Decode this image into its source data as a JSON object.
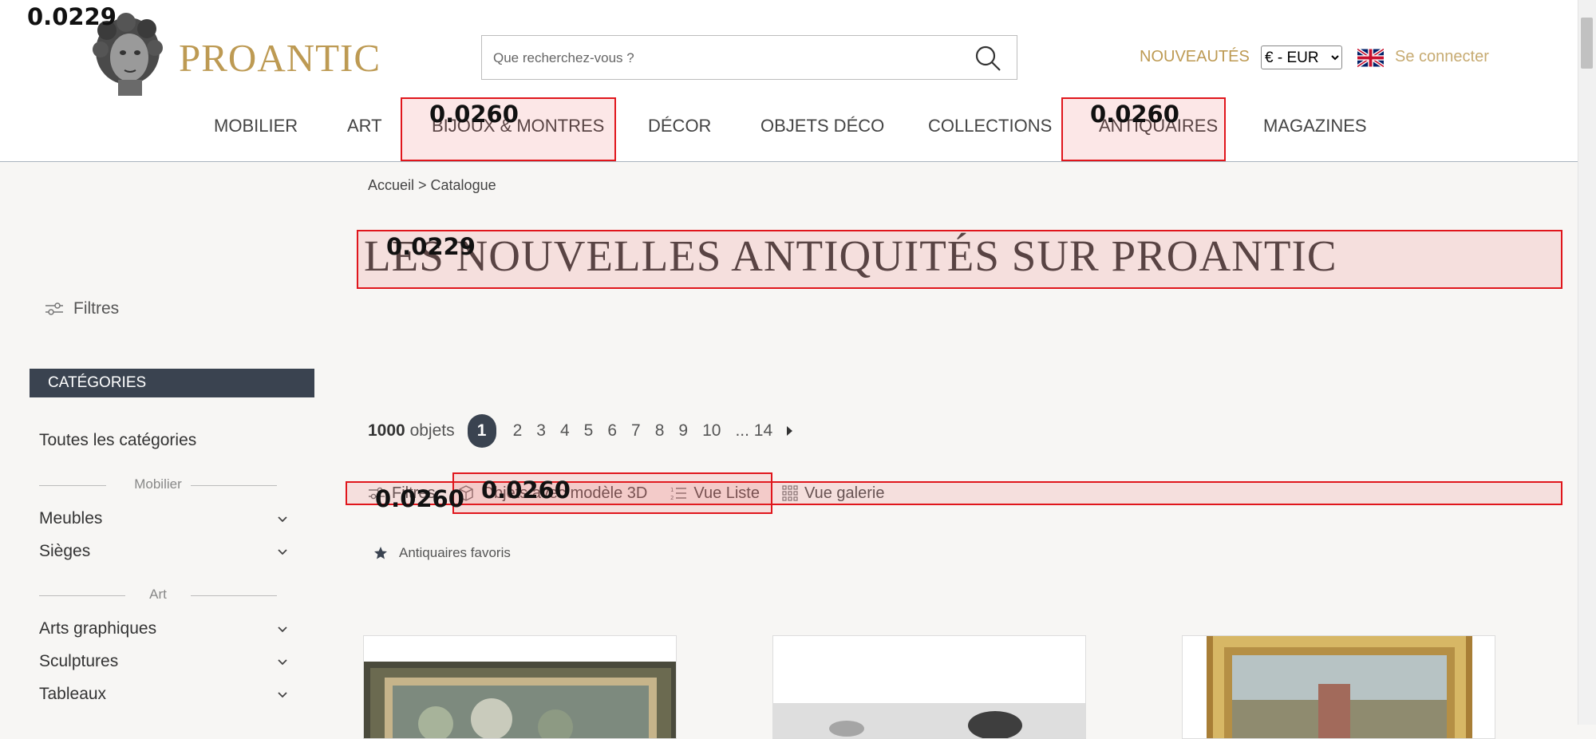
{
  "header": {
    "brand": "PROANTIC",
    "search_placeholder": "Que recherchez-vous ?",
    "nouveautes": "NOUVEAUTÉS",
    "currency": "€ - EUR",
    "login": "Se connecter"
  },
  "nav": [
    "MOBILIER",
    "ART",
    "BIJOUX & MONTRES",
    "DÉCOR",
    "OBJETS DÉCO",
    "COLLECTIONS",
    "ANTIQUAIRES",
    "MAGAZINES"
  ],
  "breadcrumb": "Accueil > Catalogue",
  "page_title": "LES NOUVELLES ANTIQUITÉS SUR PROANTIC",
  "sidebar": {
    "filters": "Filtres",
    "categories_header": "CATÉGORIES",
    "all_categories": "Toutes les catégories",
    "groups": [
      {
        "label": "Mobilier",
        "items": [
          "Meubles",
          "Sièges"
        ]
      },
      {
        "label": "Art",
        "items": [
          "Arts graphiques",
          "Sculptures",
          "Tableaux"
        ]
      }
    ]
  },
  "pagination": {
    "count": "1000",
    "count_unit": "objets",
    "pages": [
      "1",
      "2",
      "3",
      "4",
      "5",
      "6",
      "7",
      "8",
      "9",
      "10"
    ],
    "ellipsis_last": "... 14",
    "current": "1"
  },
  "toolbar": {
    "filters": "Filtres",
    "model3d": "Objets avec modèle 3D",
    "list_view": "Vue Liste",
    "gallery_view": "Vue galerie"
  },
  "favorites": "Antiquaires favoris",
  "overlays": [
    {
      "label": "0.0229"
    },
    {
      "label": "0.0260"
    },
    {
      "label": "0.0260"
    },
    {
      "label": "0.0229"
    },
    {
      "label": "0.0260"
    },
    {
      "label": "0.0260"
    }
  ],
  "colors": {
    "brand_gold": "#bd9a53",
    "dark_slate": "#3a4350",
    "overlay_red": "#e0161c"
  }
}
